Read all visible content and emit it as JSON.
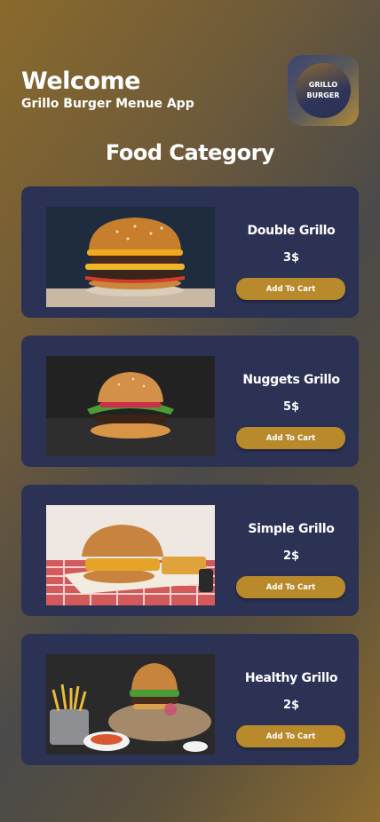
{
  "header": {
    "welcome": "Welcome",
    "subtitle": "Grillo Burger Menue App"
  },
  "logo": {
    "line1": "GRILLO",
    "line2": "BURGER"
  },
  "section_title": "Food Category",
  "items": [
    {
      "name": "Double Grillo",
      "price": "3$",
      "button": "Add To Cart"
    },
    {
      "name": "Nuggets Grillo",
      "price": "5$",
      "button": "Add To Cart"
    },
    {
      "name": "Simple Grillo",
      "price": "2$",
      "button": "Add To Cart"
    },
    {
      "name": "Healthy Grillo",
      "price": "2$",
      "button": "Add To Cart"
    }
  ],
  "colors": {
    "card": "#2b3254",
    "button": "#b88a2c",
    "gold": "#8d6c2f"
  }
}
